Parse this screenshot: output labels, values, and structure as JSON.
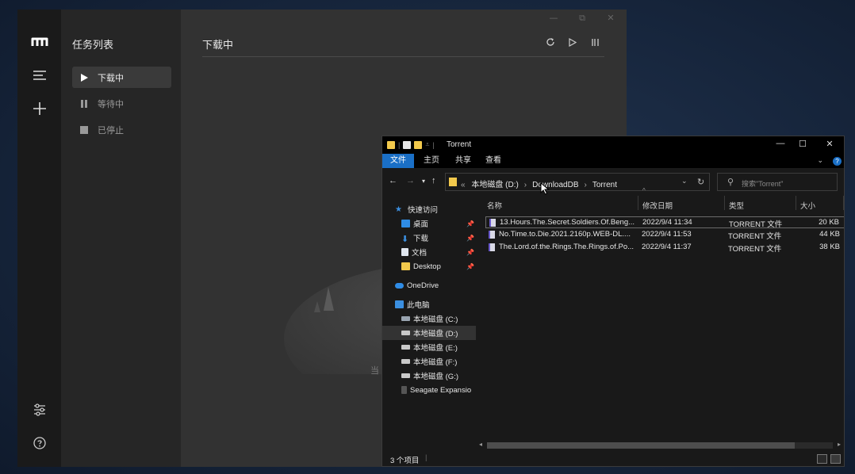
{
  "app": {
    "sidebar": {
      "title": "任务列表",
      "items": [
        {
          "label": "下载中",
          "icon": "play-icon"
        },
        {
          "label": "等待中",
          "icon": "pause-icon"
        },
        {
          "label": "已停止",
          "icon": "stop-icon"
        }
      ]
    },
    "iconbar": [
      "motrix-logo-icon",
      "menu-icon",
      "add-icon",
      "settings-icon",
      "help-icon"
    ],
    "main": {
      "header": "下载中",
      "actions": [
        "refresh-icon",
        "resume-all-icon",
        "pause-all-icon"
      ],
      "empty_text": "当"
    }
  },
  "explorer": {
    "title": "Torrent",
    "ribbon_tabs": [
      "文件",
      "主页",
      "共享",
      "查看"
    ],
    "address": [
      "本地磁盘 (D:)",
      "DownloadDB",
      "Torrent"
    ],
    "address_prefix": "«",
    "search_placeholder": "搜索\"Torrent\"",
    "tree": [
      {
        "label": "快速访问",
        "icon": "star-icon"
      },
      {
        "label": "桌面",
        "icon": "desktop-icon",
        "pinned": true
      },
      {
        "label": "下载",
        "icon": "download-icon",
        "pinned": true
      },
      {
        "label": "文档",
        "icon": "document-icon",
        "pinned": true
      },
      {
        "label": "Desktop",
        "icon": "folder-icon",
        "pinned": true
      },
      {
        "label": "OneDrive",
        "icon": "cloud-icon"
      },
      {
        "label": "此电脑",
        "icon": "computer-icon"
      },
      {
        "label": "本地磁盘 (C:)",
        "icon": "drive-icon"
      },
      {
        "label": "本地磁盘 (D:)",
        "icon": "drive-icon",
        "selected": true
      },
      {
        "label": "本地磁盘 (E:)",
        "icon": "drive-icon"
      },
      {
        "label": "本地磁盘 (F:)",
        "icon": "drive-icon"
      },
      {
        "label": "本地磁盘 (G:)",
        "icon": "drive-icon"
      },
      {
        "label": "Seagate Expansio",
        "icon": "external-drive-icon"
      }
    ],
    "columns": [
      "名称",
      "修改日期",
      "类型",
      "大小"
    ],
    "files": [
      {
        "name": "13.Hours.The.Secret.Soldiers.Of.Beng...",
        "date": "2022/9/4 11:34",
        "type": "TORRENT 文件",
        "size": "20 KB"
      },
      {
        "name": "No.Time.to.Die.2021.2160p.WEB-DL....",
        "date": "2022/9/4 11:53",
        "type": "TORRENT 文件",
        "size": "44 KB"
      },
      {
        "name": "The.Lord.of.the.Rings.The.Rings.of.Po...",
        "date": "2022/9/4 11:37",
        "type": "TORRENT 文件",
        "size": "38 KB"
      }
    ],
    "status": "3 个项目",
    "colors": {
      "accent": "#1a6fc6",
      "folder": "#f2c94c"
    }
  }
}
